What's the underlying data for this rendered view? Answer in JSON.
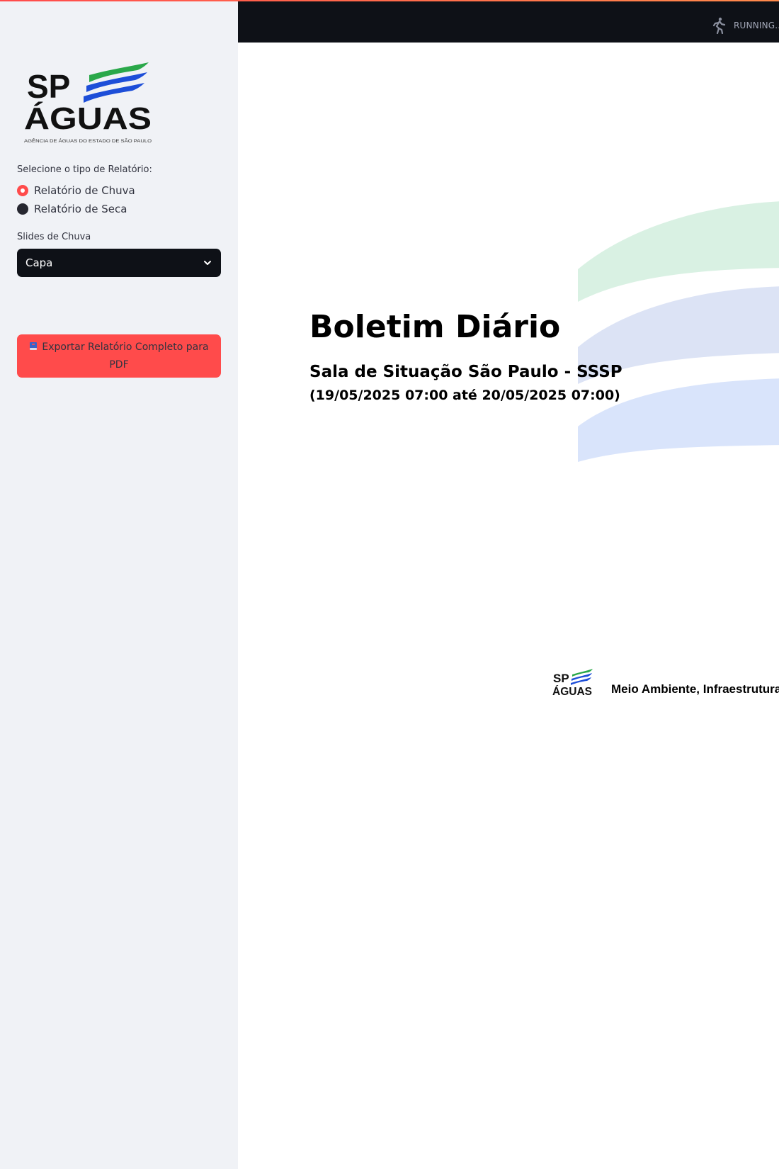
{
  "sidebar": {
    "logo": {
      "wordmark_top": "SP",
      "wordmark_bottom": "ÁGUAS",
      "tagline": "AGÊNCIA DE ÁGUAS DO ESTADO DE SÃO PAULO"
    },
    "report_type": {
      "label": "Selecione o tipo de Relatório:",
      "options": [
        {
          "label": "Relatório de Chuva",
          "selected": true
        },
        {
          "label": "Relatório de Seca",
          "selected": false
        }
      ]
    },
    "slides_select": {
      "label": "Slides de Chuva",
      "value": "Capa"
    },
    "export_button": {
      "label": "Exportar Relatório Completo para PDF",
      "icon": "book-icon"
    }
  },
  "header": {
    "status": "RUNNING...",
    "status_icon": "runner-icon"
  },
  "slide": {
    "title": "Boletim Diário",
    "subtitle": "Sala de Situação São Paulo - SSSP",
    "period": "(19/05/2025 07:00 até 20/05/2025 07:00)",
    "footer_logo": {
      "wordmark_top": "SP",
      "wordmark_bottom": "ÁGUAS"
    },
    "footer_text": "Meio Ambiente, Infraestrutura"
  },
  "colors": {
    "accent": "#ff4b4b",
    "sidebar_bg": "#f0f2f6",
    "header_bg": "#0e1117",
    "logo_green": "#2aa84a",
    "logo_blue": "#1d4ed8",
    "wave_green": "#d9f1e3",
    "wave_blue_1": "#dce3f5",
    "wave_blue_2": "#d9e4fb"
  }
}
